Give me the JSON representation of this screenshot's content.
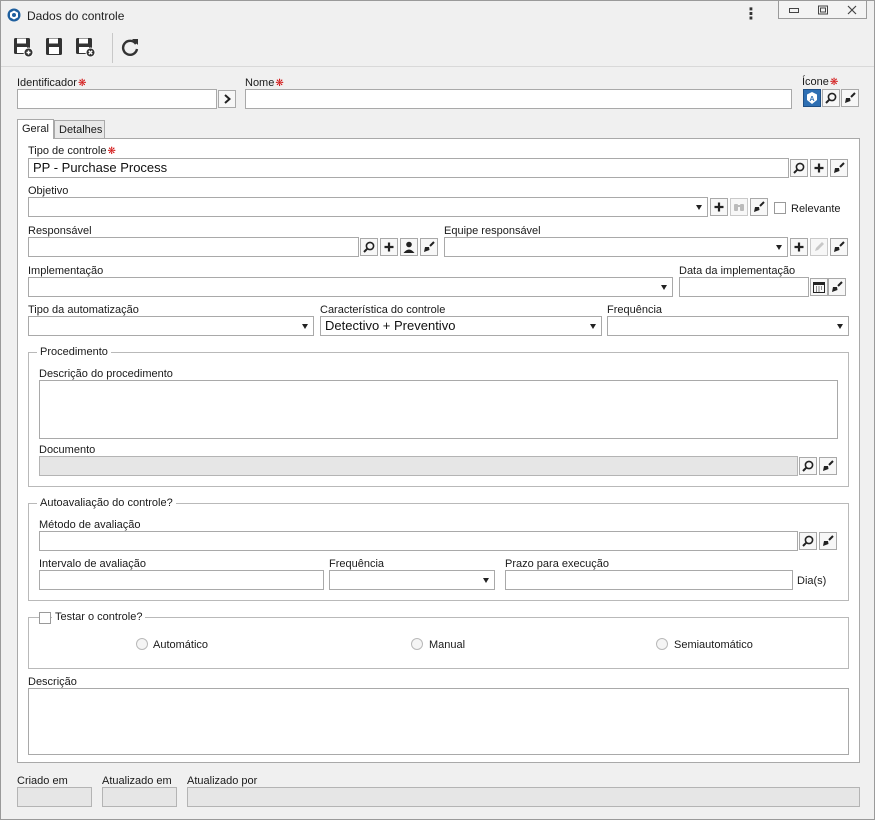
{
  "window": {
    "title": "Dados do controle"
  },
  "toolbar": {
    "buttons": [
      {
        "name": "save-and-new",
        "icon": "save-new-icon"
      },
      {
        "name": "save",
        "icon": "save-icon"
      },
      {
        "name": "save-and-close",
        "icon": "save-close-icon"
      },
      {
        "name": "refresh",
        "icon": "refresh-icon"
      }
    ]
  },
  "header": {
    "identificador_label": "Identificador",
    "identificador_value": "",
    "nome_label": "Nome",
    "nome_value": "",
    "icone_label": "Ícone"
  },
  "tabs": [
    {
      "label": "Geral",
      "active": true
    },
    {
      "label": "Detalhes",
      "active": false
    }
  ],
  "geral": {
    "tipo_controle_label": "Tipo de controle",
    "tipo_controle_value": "PP - Purchase Process",
    "objetivo_label": "Objetivo",
    "objetivo_value": "",
    "relevante_label": "Relevante",
    "responsavel_label": "Responsável",
    "responsavel_value": "",
    "equipe_label": "Equipe responsável",
    "equipe_value": "",
    "implementacao_label": "Implementação",
    "implementacao_value": "",
    "data_implementacao_label": "Data da implementação",
    "data_implementacao_value": "",
    "tipo_automatizacao_label": "Tipo da automatização",
    "tipo_automatizacao_value": "",
    "caracteristica_label": "Característica do controle",
    "caracteristica_value": "Detectivo + Preventivo",
    "frequencia_label": "Frequência",
    "frequencia_value": ""
  },
  "procedimento": {
    "legend": "Procedimento",
    "descricao_label": "Descrição do procedimento",
    "descricao_value": "",
    "documento_label": "Documento",
    "documento_value": ""
  },
  "autoavaliacao": {
    "legend": "Autoavaliação do controle?",
    "metodo_label": "Método de avaliação",
    "metodo_value": "",
    "intervalo_label": "Intervalo de avaliação",
    "intervalo_value": "",
    "frequencia_label": "Frequência",
    "frequencia_value": "",
    "prazo_label": "Prazo para execução",
    "prazo_value": "",
    "prazo_unit": "Dia(s)"
  },
  "testar": {
    "legend": "Testar o controle?",
    "options": [
      "Automático",
      "Manual",
      "Semiautomático"
    ]
  },
  "descricao": {
    "label": "Descrição",
    "value": ""
  },
  "footer": {
    "criado_label": "Criado em",
    "atualizado_label": "Atualizado em",
    "atualizado_por_label": "Atualizado por"
  },
  "colors": {
    "accent": "#2e6fb3",
    "required": "#d21010"
  }
}
